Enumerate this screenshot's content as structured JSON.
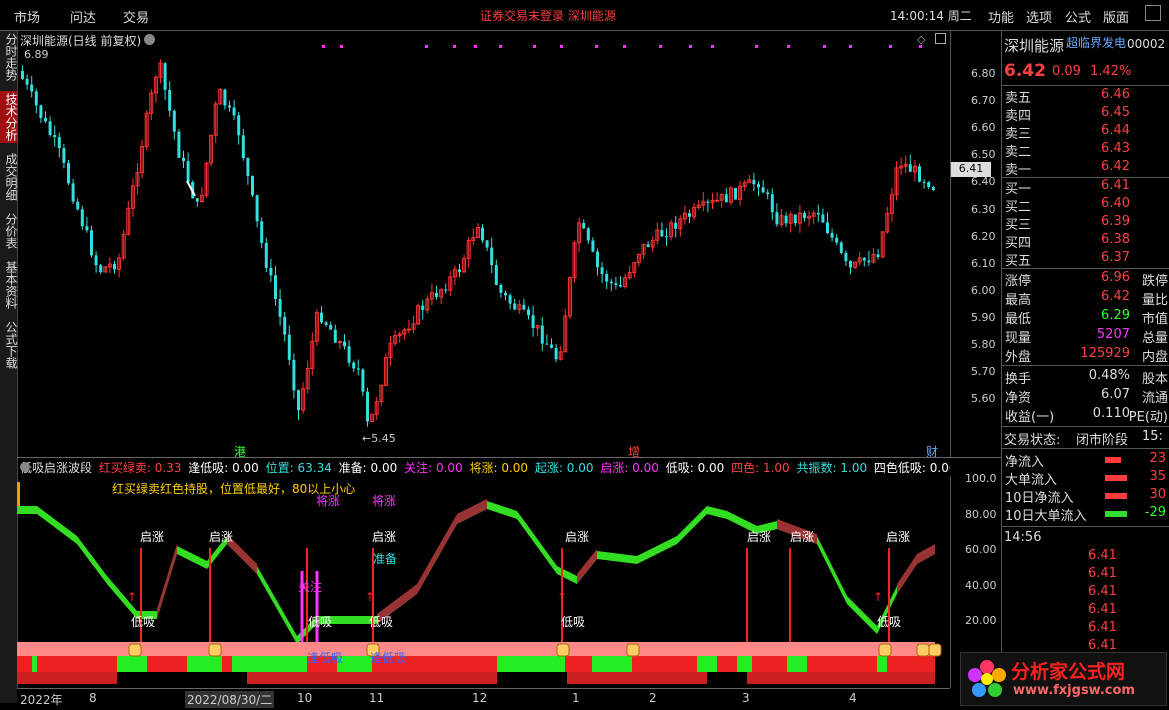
{
  "menu": {
    "market": "市场",
    "wenda": "问达",
    "trade": "交易",
    "notice": "证券交易未登录  深圳能源",
    "clock": "14:00:14 周二",
    "func": "功能",
    "options": "选项",
    "formula": "公式",
    "layout": "版面"
  },
  "left_tabs": [
    "分时走势",
    "技术分析",
    "成交明细",
    "分价表",
    "基本资料",
    "公式下载"
  ],
  "chart": {
    "title": "深圳能源(日线 前复权)",
    "high_label": "6.89",
    "low_label": "←5.45",
    "current_price_tag": "6.41",
    "y_ticks": [
      "6.80",
      "6.70",
      "6.60",
      "6.50",
      "6.40",
      "6.30",
      "6.20",
      "6.10",
      "6.00",
      "5.90",
      "5.80",
      "5.70",
      "5.60"
    ],
    "markers": {
      "gang": "港",
      "zeng": "增",
      "cai": "财"
    },
    "colors": {
      "up": "#ff3333",
      "down": "#33e0e0"
    }
  },
  "indicator": {
    "name": "低吸启涨波段",
    "fields": [
      {
        "label": "红买绿卖:",
        "value": "0.33",
        "color": "#ff4040"
      },
      {
        "label": "逢低吸:",
        "value": "0.00",
        "color": "#ffffff"
      },
      {
        "label": "位置:",
        "value": "63.34",
        "color": "#33e0e0"
      },
      {
        "label": "准备:",
        "value": "0.00",
        "color": "#ffffff"
      },
      {
        "label": "关注:",
        "value": "0.00",
        "color": "#ff33ff"
      },
      {
        "label": "将涨:",
        "value": "0.00",
        "color": "#ffd000"
      },
      {
        "label": "起涨:",
        "value": "0.00",
        "color": "#33e0e0"
      },
      {
        "label": "启涨:",
        "value": "0.00",
        "color": "#ff33ff"
      },
      {
        "label": "低吸:",
        "value": "0.00",
        "color": "#ffffff"
      },
      {
        "label": "四色:",
        "value": "1.00",
        "color": "#ff4040"
      },
      {
        "label": "共振数:",
        "value": "1.00",
        "color": "#33e0e0"
      },
      {
        "label": "四色低吸:",
        "value": "0.00",
        "color": "#ffffff"
      }
    ],
    "note": "红买绿卖红色持股，位置低最好，80以上小心",
    "y_ticks": [
      "100.0",
      "80.00",
      "60.00",
      "40.00",
      "20.00"
    ],
    "labels": {
      "qizhang": "启涨",
      "dixi": "低吸",
      "jiangzhang": "将涨",
      "zhunbei": "准备",
      "guanzhu": "关注",
      "fengdixi": "逢低吸"
    }
  },
  "x_axis": [
    "2022年",
    "8",
    "2022/08/30/二",
    "10",
    "11",
    "12",
    "1",
    "2",
    "3",
    "4"
  ],
  "quote": {
    "name": "深圳能源",
    "badge": "超临界发电",
    "code": "00002",
    "price": "6.42",
    "change": "0.09",
    "pct": "1.42%",
    "asks": [
      {
        "l": "卖五",
        "v": "6.46"
      },
      {
        "l": "卖四",
        "v": "6.45"
      },
      {
        "l": "卖三",
        "v": "6.44"
      },
      {
        "l": "卖二",
        "v": "6.43"
      },
      {
        "l": "卖一",
        "v": "6.42"
      }
    ],
    "bids": [
      {
        "l": "买一",
        "v": "6.41"
      },
      {
        "l": "买二",
        "v": "6.40"
      },
      {
        "l": "买三",
        "v": "6.39"
      },
      {
        "l": "买四",
        "v": "6.38"
      },
      {
        "l": "买五",
        "v": "6.37"
      }
    ],
    "stats": [
      {
        "l": "涨停",
        "v": "6.96",
        "c": "red",
        "r": "跌停"
      },
      {
        "l": "最高",
        "v": "6.42",
        "c": "red",
        "r": "量比"
      },
      {
        "l": "最低",
        "v": "6.29",
        "c": "grn",
        "r": "市值"
      },
      {
        "l": "现量",
        "v": "5207",
        "c": "mag",
        "r": "总量"
      },
      {
        "l": "外盘",
        "v": "125929",
        "c": "red",
        "r": "内盘"
      }
    ],
    "stats2": [
      {
        "l": "换手",
        "v": "0.48%",
        "c": "wht",
        "r": "股本"
      },
      {
        "l": "净资",
        "v": "6.07",
        "c": "wht",
        "r": "流通"
      },
      {
        "l": "收益(一)",
        "v": "0.110",
        "c": "wht",
        "r": "PE(动)"
      }
    ],
    "status_label": "交易状态:",
    "status_value": "闭市阶段",
    "status_time": "15:",
    "flows": [
      {
        "l": "净流入",
        "v": "23"
      },
      {
        "l": "大单流入",
        "v": "35"
      },
      {
        "l": "10日净流入",
        "v": "30"
      },
      {
        "l": "10日大单流入",
        "v": "-29"
      }
    ],
    "tick_time": "14:56",
    "ticks": [
      "6.41",
      "6.41",
      "6.41",
      "6.41",
      "6.41",
      "6.41",
      "6.41"
    ]
  },
  "logo": {
    "main": "分析家公式网",
    "sub": "www.fxjgsw.com"
  }
}
